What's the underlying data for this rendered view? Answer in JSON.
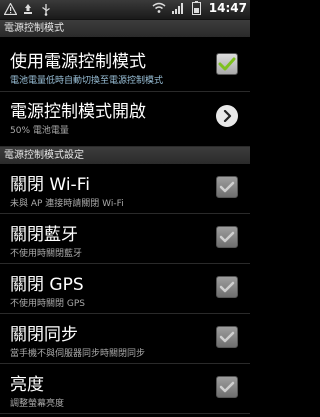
{
  "status_bar": {
    "left_icons": [
      "warning-icon",
      "recycle-icon",
      "usb-icon"
    ],
    "right_icons": [
      "wifi-icon",
      "signal-icon",
      "battery-icon"
    ],
    "time": "14:47"
  },
  "sections": [
    {
      "header": "電源控制模式",
      "rows": [
        {
          "title": "使用電源控制模式",
          "subtitle": "電池電量低時自動切換至電源控制模式",
          "control": "checkbox",
          "checked": true,
          "enabled": true
        },
        {
          "title": "電源控制模式開啟",
          "subtitle": "50% 電池電量",
          "control": "chevron"
        }
      ]
    },
    {
      "header": "電源控制模式設定",
      "rows": [
        {
          "title": "關閉 Wi-Fi",
          "subtitle": "未與 AP 連接時請關閉 Wi-Fi",
          "control": "checkbox",
          "checked": true,
          "enabled": false
        },
        {
          "title": "關閉藍牙",
          "subtitle": "不使用時關閉藍牙",
          "control": "checkbox",
          "checked": true,
          "enabled": false
        },
        {
          "title": "關閉 GPS",
          "subtitle": "不使用時關閉 GPS",
          "control": "checkbox",
          "checked": true,
          "enabled": false
        },
        {
          "title": "關閉同步",
          "subtitle": "當手機不與伺服器同步時關閉同步",
          "control": "checkbox",
          "checked": true,
          "enabled": false
        },
        {
          "title": "亮度",
          "subtitle": "調整螢幕亮度",
          "control": "checkbox",
          "checked": true,
          "enabled": false
        }
      ]
    }
  ],
  "colors": {
    "check_active": "#7ec11f",
    "check_disabled": "#cfcfcf",
    "subtitle_blue": "#9ac0d8"
  }
}
